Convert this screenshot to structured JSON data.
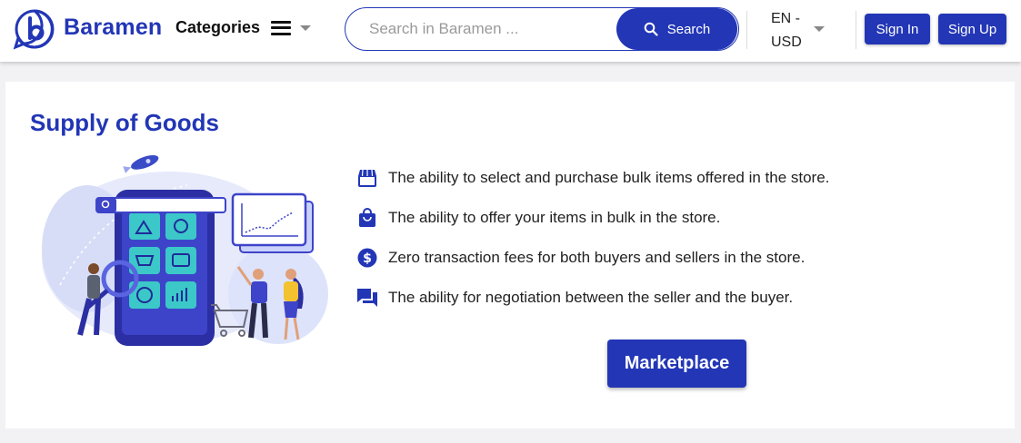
{
  "header": {
    "brand": "Baramen",
    "categories_label": "Categories",
    "search": {
      "placeholder": "Search in Baramen ...",
      "button_label": "Search"
    },
    "language": "EN -",
    "currency": "USD",
    "sign_in_label": "Sign In",
    "sign_up_label": "Sign Up"
  },
  "section": {
    "title": "Supply of Goods",
    "features": [
      {
        "icon": "store-icon",
        "text": "The ability to select and purchase bulk items offered in the store."
      },
      {
        "icon": "shopping-bag-icon",
        "text": "The ability to offer your items in bulk in the store."
      },
      {
        "icon": "dollar-circle-icon",
        "text": "Zero transaction fees for both buyers and sellers in the store."
      },
      {
        "icon": "chat-icon",
        "text": "The ability for negotiation between the seller and the buyer."
      }
    ],
    "cta_label": "Marketplace"
  },
  "colors": {
    "brand": "#2236b6",
    "background": "#f2f2f5",
    "card": "#ffffff",
    "accent_teal": "#3cc8c8"
  }
}
